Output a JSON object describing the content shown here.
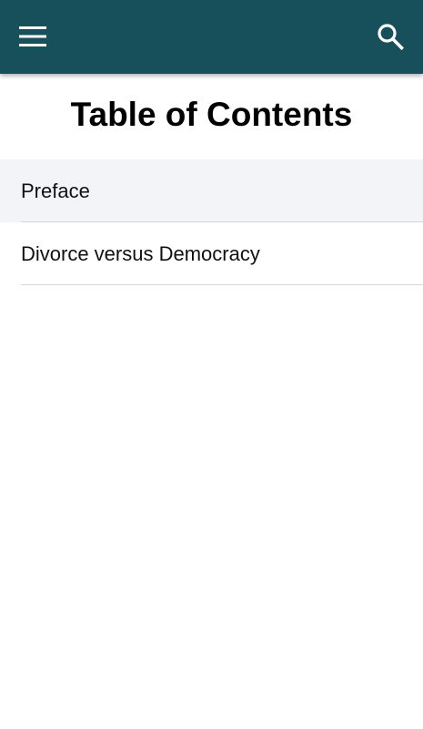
{
  "colors": {
    "app_bar": "#174f5b",
    "icon": "#ffffff",
    "selected_row": "#f3f4f7",
    "divider": "#d4d4d4"
  },
  "app_bar": {
    "menu_icon": "hamburger-menu-icon",
    "search_icon": "search-icon"
  },
  "page": {
    "title": "Table of Contents"
  },
  "toc": {
    "items": [
      {
        "label": "Preface",
        "selected": true
      },
      {
        "label": "Divorce versus Democracy",
        "selected": false
      }
    ]
  }
}
